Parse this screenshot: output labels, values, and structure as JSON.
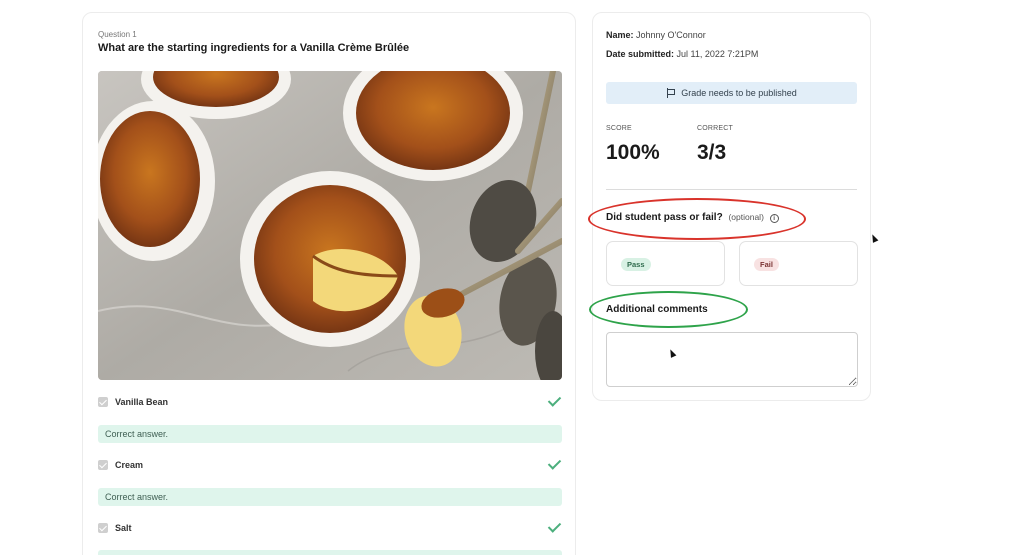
{
  "question": {
    "number_label": "Question 1",
    "title": "What are the starting ingredients for a Vanilla Crème Brûlée",
    "answers": [
      {
        "label": "Vanilla Bean",
        "feedback": "Correct answer."
      },
      {
        "label": "Cream",
        "feedback": "Correct answer."
      },
      {
        "label": "Salt",
        "feedback": ""
      }
    ]
  },
  "grading": {
    "name_label": "Name:",
    "name_value": "Johnny O'Connor",
    "date_label": "Date submitted:",
    "date_value": "Jul 11, 2022 7:21PM",
    "publish_notice": "Grade needs to be published",
    "score_label": "SCORE",
    "score_value": "100%",
    "correct_label": "CORRECT",
    "correct_value": "3/3",
    "pass_fail_question": "Did student pass or fail?",
    "pass_fail_optional": "(optional)",
    "pass_label": "Pass",
    "fail_label": "Fail",
    "comments_label": "Additional comments",
    "comments_value": ""
  },
  "colors": {
    "correct_green": "#4caf7d",
    "feedback_bg": "#dff5ec",
    "publish_bg": "#e2eef8",
    "annotation_red": "#d9332b",
    "annotation_green": "#2ea34a"
  },
  "icons": [
    "check-icon",
    "flag-icon",
    "info-icon",
    "mouse-cursor-icon"
  ]
}
